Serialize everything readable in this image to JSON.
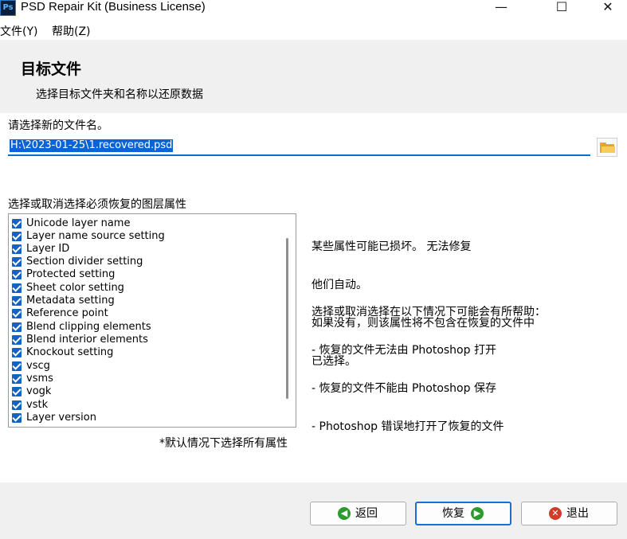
{
  "window": {
    "title": "PSD Repair Kit (Business License)"
  },
  "menu": {
    "file": "文件(Y)",
    "help": "帮助(Z)"
  },
  "header": {
    "title": "目标文件",
    "subtitle": "选择目标文件夹和名称以还原数据"
  },
  "filename": {
    "label": "请选择新的文件名。",
    "value": "H:\\2023-01-25\\1.recovered.psd"
  },
  "attributes": {
    "label": "选择或取消选择必须恢复的图层属性",
    "items": [
      "Unicode layer name",
      "Layer name source setting",
      "Layer ID",
      "Section divider setting",
      "Protected setting",
      "Sheet color setting",
      "Metadata setting",
      "Reference point",
      "Blend clipping elements",
      "Blend interior elements",
      "Knockout setting",
      "vscg",
      "vsms",
      "vogk",
      "vstk",
      "Layer version"
    ],
    "default_note": "*默认情况下选择所有属性"
  },
  "help": {
    "p1": [
      "某些属性可能已损坏。 无法修复",
      "他们自动。",
      "如果没有，则该属性将不包含在恢复的文件中",
      "已选择。"
    ],
    "p2": [
      "选择或取消选择在以下情况下可能会有所帮助：",
      "- 恢复的文件无法由 Photoshop 打开",
      "- 恢复的文件不能由 Photoshop 保存",
      "- Photoshop 错误地打开了恢复的文件"
    ]
  },
  "buttons": {
    "back": "返回",
    "recover": "恢复",
    "exit": "退出"
  },
  "icons": {
    "app": "Ps",
    "minimize": "—",
    "maximize": "☐",
    "close": "✕",
    "back": "◀",
    "recover": "▶",
    "exit": "✕"
  },
  "colors": {
    "accent": "#0f6fc6",
    "green": "#2c9a2c",
    "red": "#d23a2a",
    "folder": "#e3a72c"
  }
}
